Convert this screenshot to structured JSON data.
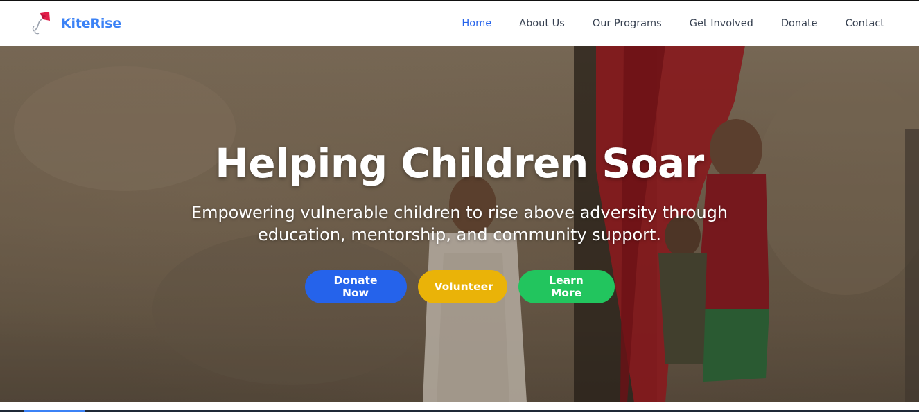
{
  "brand": {
    "name": "KiteRise",
    "logo_icon": "kite-icon",
    "color": "#3b82f6"
  },
  "nav": {
    "items": [
      {
        "label": "Home",
        "active": true
      },
      {
        "label": "About Us",
        "active": false
      },
      {
        "label": "Our Programs",
        "active": false
      },
      {
        "label": "Get Involved",
        "active": false
      },
      {
        "label": "Donate",
        "active": false
      },
      {
        "label": "Contact",
        "active": false
      }
    ],
    "active_color": "#2563eb",
    "text_color": "#374151"
  },
  "hero": {
    "title": "Helping Children Soar",
    "subtitle_line1": "Empowering vulnerable children to rise above adversity through",
    "subtitle_line2": "education, mentorship, and community support.",
    "buttons": {
      "donate": {
        "label": "Donate Now",
        "color": "#2563eb"
      },
      "volunteer": {
        "label": "Volunteer",
        "color": "#eab308"
      },
      "learn_more": {
        "label": "Learn More",
        "color": "#22c55e"
      }
    }
  }
}
